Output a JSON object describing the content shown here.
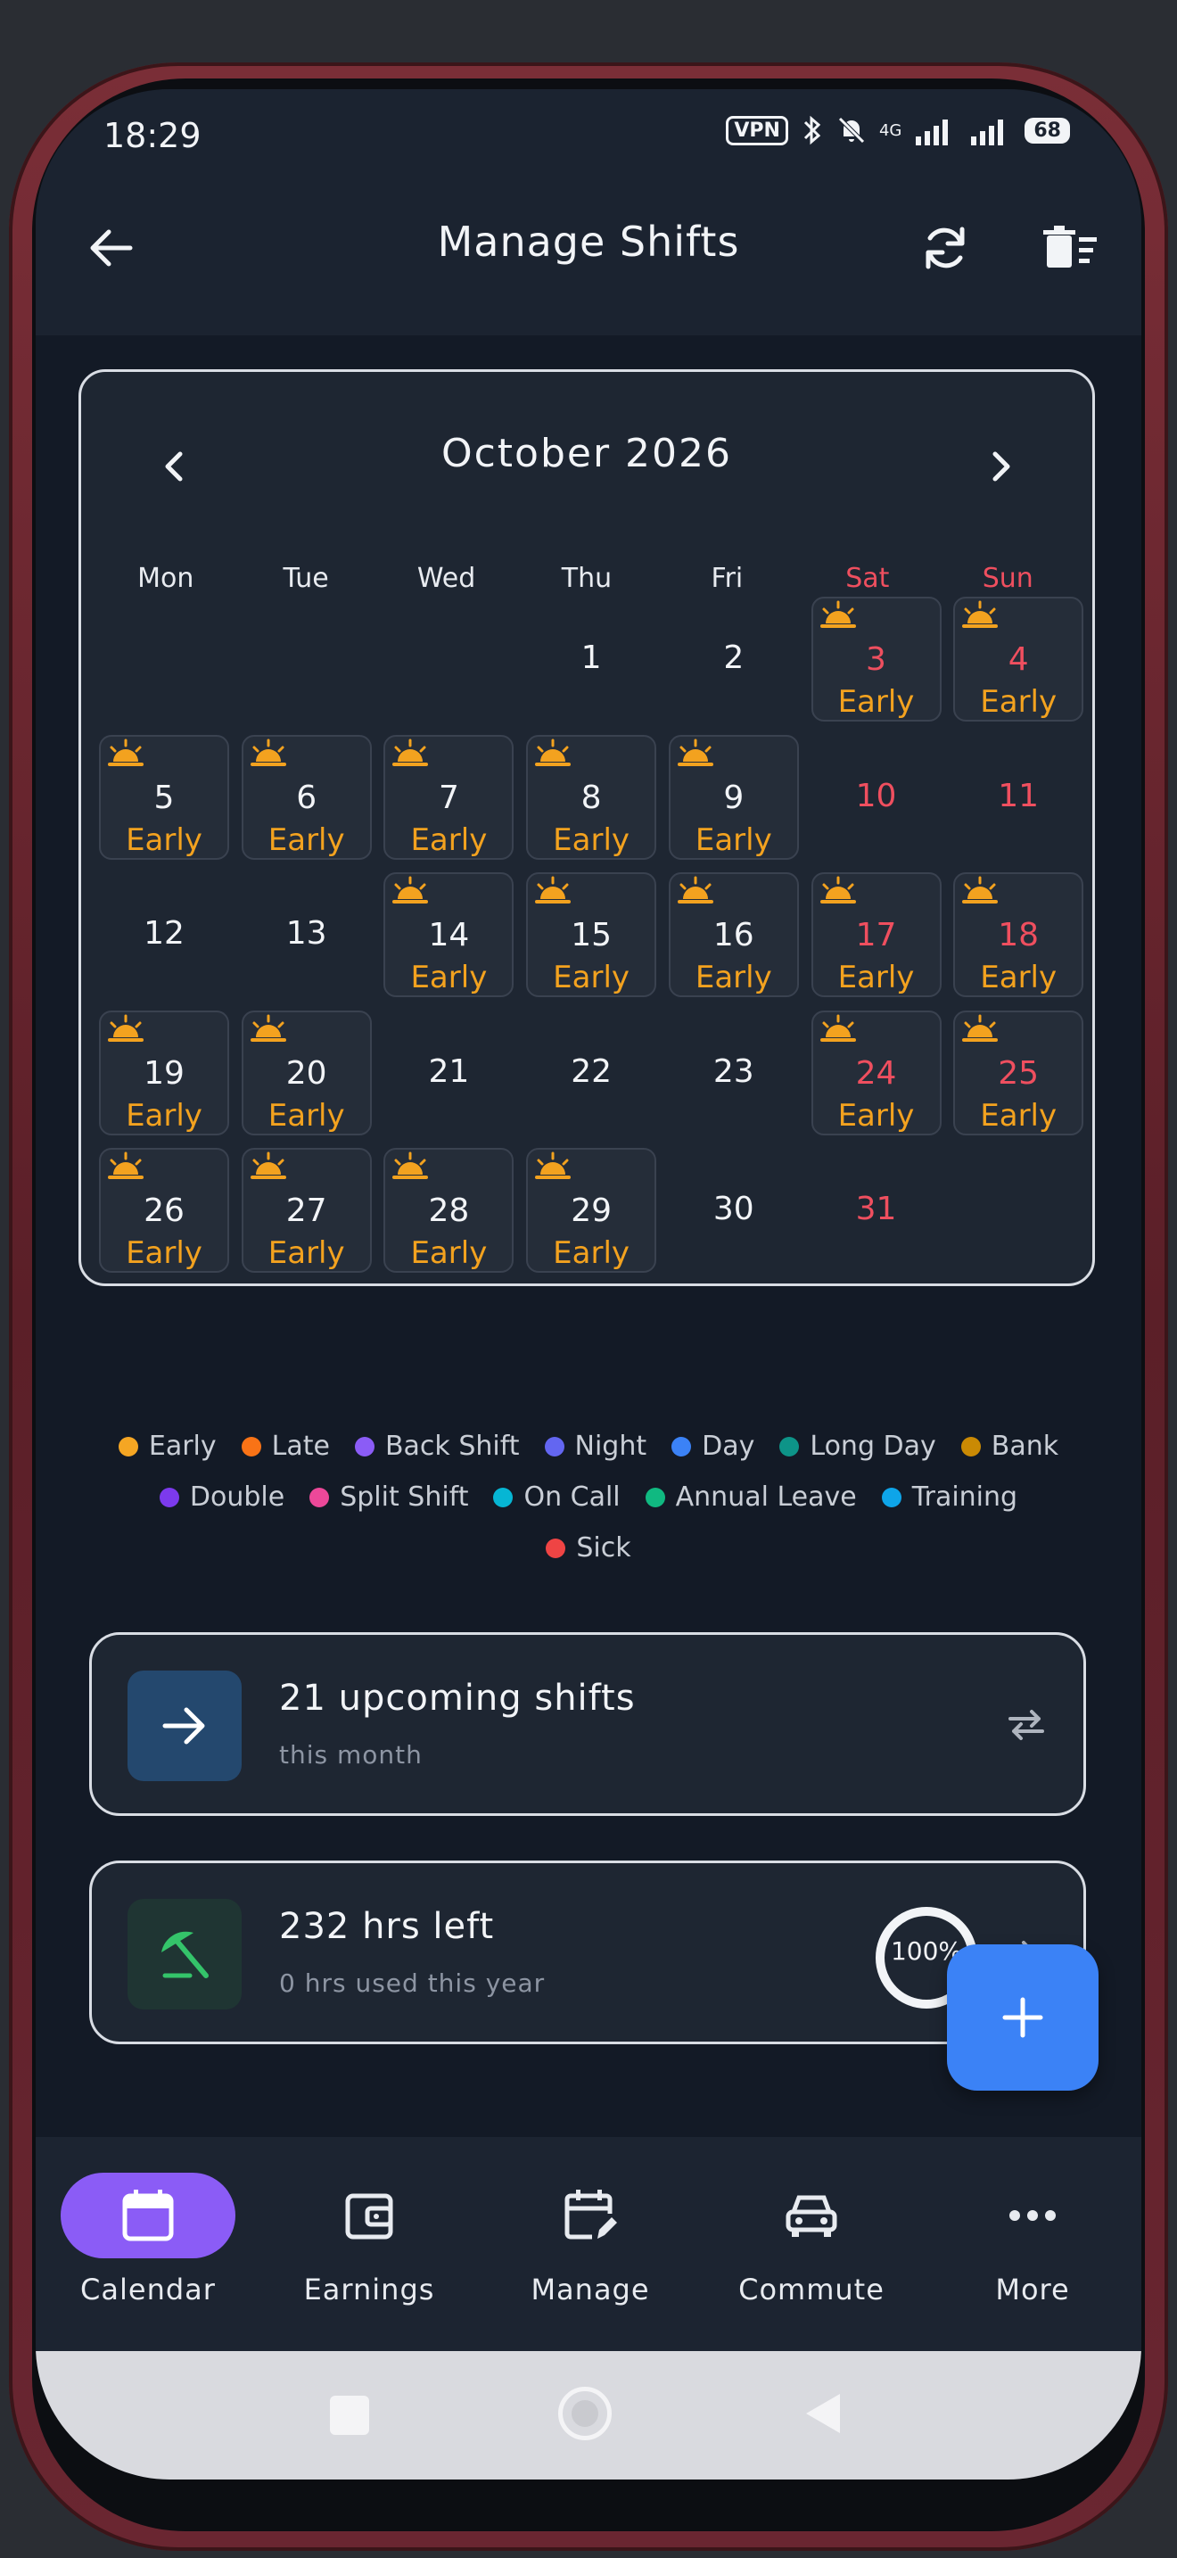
{
  "status_bar": {
    "time": "18:29",
    "vpn": "VPN",
    "network": "4G",
    "battery": "68"
  },
  "header": {
    "title": "Manage Shifts"
  },
  "calendar": {
    "month_label": "October 2026",
    "weekdays": [
      "Mon",
      "Tue",
      "Wed",
      "Thu",
      "Fri",
      "Sat",
      "Sun"
    ],
    "days": [
      {
        "day": "1",
        "col": 3,
        "row": 0,
        "shift": ""
      },
      {
        "day": "2",
        "col": 4,
        "row": 0,
        "shift": ""
      },
      {
        "day": "3",
        "col": 5,
        "row": 0,
        "shift": "Early"
      },
      {
        "day": "4",
        "col": 6,
        "row": 0,
        "shift": "Early"
      },
      {
        "day": "5",
        "col": 0,
        "row": 1,
        "shift": "Early"
      },
      {
        "day": "6",
        "col": 1,
        "row": 1,
        "shift": "Early"
      },
      {
        "day": "7",
        "col": 2,
        "row": 1,
        "shift": "Early"
      },
      {
        "day": "8",
        "col": 3,
        "row": 1,
        "shift": "Early"
      },
      {
        "day": "9",
        "col": 4,
        "row": 1,
        "shift": "Early"
      },
      {
        "day": "10",
        "col": 5,
        "row": 1,
        "shift": ""
      },
      {
        "day": "11",
        "col": 6,
        "row": 1,
        "shift": ""
      },
      {
        "day": "12",
        "col": 0,
        "row": 2,
        "shift": ""
      },
      {
        "day": "13",
        "col": 1,
        "row": 2,
        "shift": ""
      },
      {
        "day": "14",
        "col": 2,
        "row": 2,
        "shift": "Early"
      },
      {
        "day": "15",
        "col": 3,
        "row": 2,
        "shift": "Early"
      },
      {
        "day": "16",
        "col": 4,
        "row": 2,
        "shift": "Early"
      },
      {
        "day": "17",
        "col": 5,
        "row": 2,
        "shift": "Early"
      },
      {
        "day": "18",
        "col": 6,
        "row": 2,
        "shift": "Early"
      },
      {
        "day": "19",
        "col": 0,
        "row": 3,
        "shift": "Early"
      },
      {
        "day": "20",
        "col": 1,
        "row": 3,
        "shift": "Early"
      },
      {
        "day": "21",
        "col": 2,
        "row": 3,
        "shift": ""
      },
      {
        "day": "22",
        "col": 3,
        "row": 3,
        "shift": ""
      },
      {
        "day": "23",
        "col": 4,
        "row": 3,
        "shift": ""
      },
      {
        "day": "24",
        "col": 5,
        "row": 3,
        "shift": "Early"
      },
      {
        "day": "25",
        "col": 6,
        "row": 3,
        "shift": "Early"
      },
      {
        "day": "26",
        "col": 0,
        "row": 4,
        "shift": "Early"
      },
      {
        "day": "27",
        "col": 1,
        "row": 4,
        "shift": "Early"
      },
      {
        "day": "28",
        "col": 2,
        "row": 4,
        "shift": "Early"
      },
      {
        "day": "29",
        "col": 3,
        "row": 4,
        "shift": "Early"
      },
      {
        "day": "30",
        "col": 4,
        "row": 4,
        "shift": ""
      },
      {
        "day": "31",
        "col": 5,
        "row": 4,
        "shift": ""
      }
    ]
  },
  "legend": {
    "rows": [
      [
        {
          "label": "Early",
          "color": "#f5a623"
        },
        {
          "label": "Late",
          "color": "#f97316"
        },
        {
          "label": "Back Shift",
          "color": "#8b5cf6"
        },
        {
          "label": "Night",
          "color": "#6366f1"
        },
        {
          "label": "Day",
          "color": "#3b82f6"
        },
        {
          "label": "Long Day",
          "color": "#0d9488"
        },
        {
          "label": "Bank",
          "color": "#ca8a04"
        }
      ],
      [
        {
          "label": "Double",
          "color": "#7c3aed"
        },
        {
          "label": "Split Shift",
          "color": "#ec4899"
        },
        {
          "label": "On Call",
          "color": "#06b6d4"
        },
        {
          "label": "Annual Leave",
          "color": "#10b981"
        },
        {
          "label": "Training",
          "color": "#0ea5e9"
        }
      ],
      [
        {
          "label": "Sick",
          "color": "#ef4444"
        }
      ]
    ]
  },
  "upcoming": {
    "title": "21 upcoming shifts",
    "subtitle": "this month"
  },
  "leave": {
    "title": "232 hrs left",
    "subtitle": "0 hrs used this year",
    "progress_label": "100%",
    "progress": 1.0
  },
  "bottom_nav": [
    {
      "label": "Calendar",
      "icon": "calendar-icon",
      "active": true
    },
    {
      "label": "Earnings",
      "icon": "wallet-icon",
      "active": false
    },
    {
      "label": "Manage",
      "icon": "calendar-edit-icon",
      "active": false
    },
    {
      "label": "Commute",
      "icon": "car-icon",
      "active": false
    },
    {
      "label": "More",
      "icon": "more-dots-icon",
      "active": false
    }
  ],
  "colors": {
    "accent": "#8b5cf6",
    "fab": "#3b82f6",
    "weekend": "#ef4f5f",
    "early": "#f3a21f"
  }
}
